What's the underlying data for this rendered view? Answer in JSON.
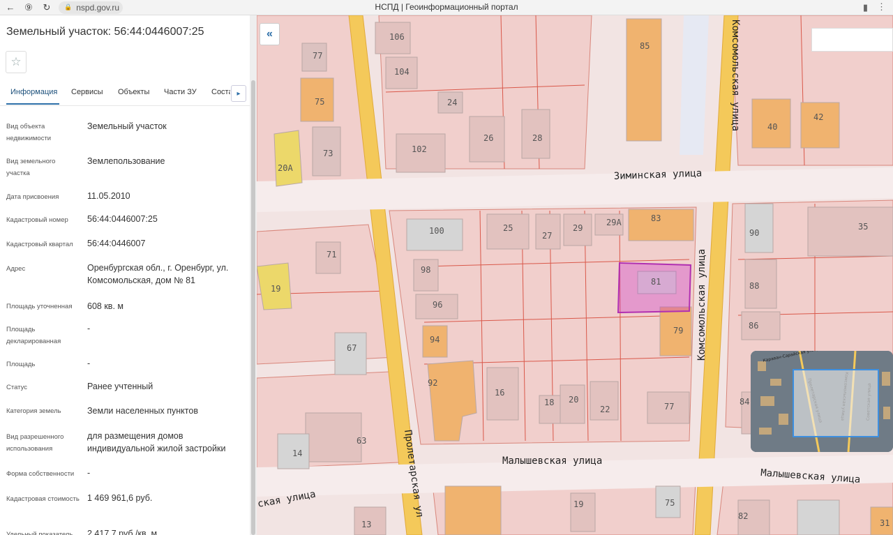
{
  "browser": {
    "url": "nspd.gov.ru",
    "tab_title": "НСПД | Геоинформационный портал",
    "back_icon": "arrow-left-icon",
    "reload_icon": "reload-icon"
  },
  "panel": {
    "title": "Земельный участок: 56:44:0446007:25",
    "favorite_icon": "star-icon",
    "tabs": [
      "Информация",
      "Сервисы",
      "Объекты",
      "Части ЗУ"
    ],
    "tab_clipped": "Состав",
    "active_tab": "Информация",
    "rows": [
      {
        "label": "Вид объекта недвижимости",
        "value": "Земельный участок"
      },
      {
        "label": "Вид земельного участка",
        "value": "Землепользование"
      },
      {
        "label": "Дата присвоения",
        "value": "11.05.2010"
      },
      {
        "label": "Кадастровый номер",
        "value": "56:44:0446007:25"
      },
      {
        "label": "Кадастровый квартал",
        "value": "56:44:0446007"
      },
      {
        "label": "Адрес",
        "value": "Оренбургская обл., г. Оренбург, ул. Комсомольская, дом № 81"
      },
      {
        "label": "Площадь уточненная",
        "value": "608 кв. м"
      },
      {
        "label": "Площадь декларированная",
        "value": "-"
      },
      {
        "label": "Площадь",
        "value": "-"
      },
      {
        "label": "Статус",
        "value": "Ранее учтенный"
      },
      {
        "label": "Категория земель",
        "value": "Земли населенных пунктов"
      },
      {
        "label": "Вид разрешенного использования",
        "value": "для размещения домов индивидуальной жилой застройки"
      },
      {
        "label": "Форма собственности",
        "value": "-"
      },
      {
        "label": "Кадастровая стоимость",
        "value": "1 469 961,6 руб."
      },
      {
        "label": "Удельный показатель",
        "value": "2 417,7 руб./кв. м"
      }
    ]
  },
  "map": {
    "streets": [
      {
        "name": "Зиминская улица"
      },
      {
        "name": "Малышевская улица"
      },
      {
        "name": "Малышевская улица"
      },
      {
        "name": "Пролетарская ул"
      },
      {
        "name": "Комсомольская улица"
      },
      {
        "name": "Комсомольская улица"
      },
      {
        "name": "ская улица"
      }
    ],
    "parcel_labels": [
      "106",
      "104",
      "77",
      "75",
      "24",
      "26",
      "28",
      "102",
      "73",
      "20А",
      "85",
      "40",
      "42",
      "25",
      "27",
      "29",
      "29А",
      "83",
      "100",
      "90",
      "35",
      "71",
      "98",
      "81",
      "96",
      "88",
      "19",
      "94",
      "86",
      "79",
      "67",
      "92",
      "16",
      "18",
      "20",
      "22",
      "77",
      "63",
      "14",
      "84",
      "19",
      "75",
      "13",
      "82",
      "31"
    ],
    "selected_parcel": "81",
    "minimap_labels": [
      "Караван-Сарайская улица",
      "Пролетарская улица",
      "Комсомольская улица",
      "Советская улица"
    ],
    "colors": {
      "selected": "#cc33cc",
      "parcel": "#f0c9c6",
      "building_orange": "#f0b36f",
      "building_yellow": "#ecd86a",
      "building_gray": "#d5d5d5",
      "road": "#f2c84a",
      "boundary": "#d04a3a"
    }
  },
  "controls": {
    "collapse_label": "«",
    "panel_tabs_next": "▸"
  }
}
